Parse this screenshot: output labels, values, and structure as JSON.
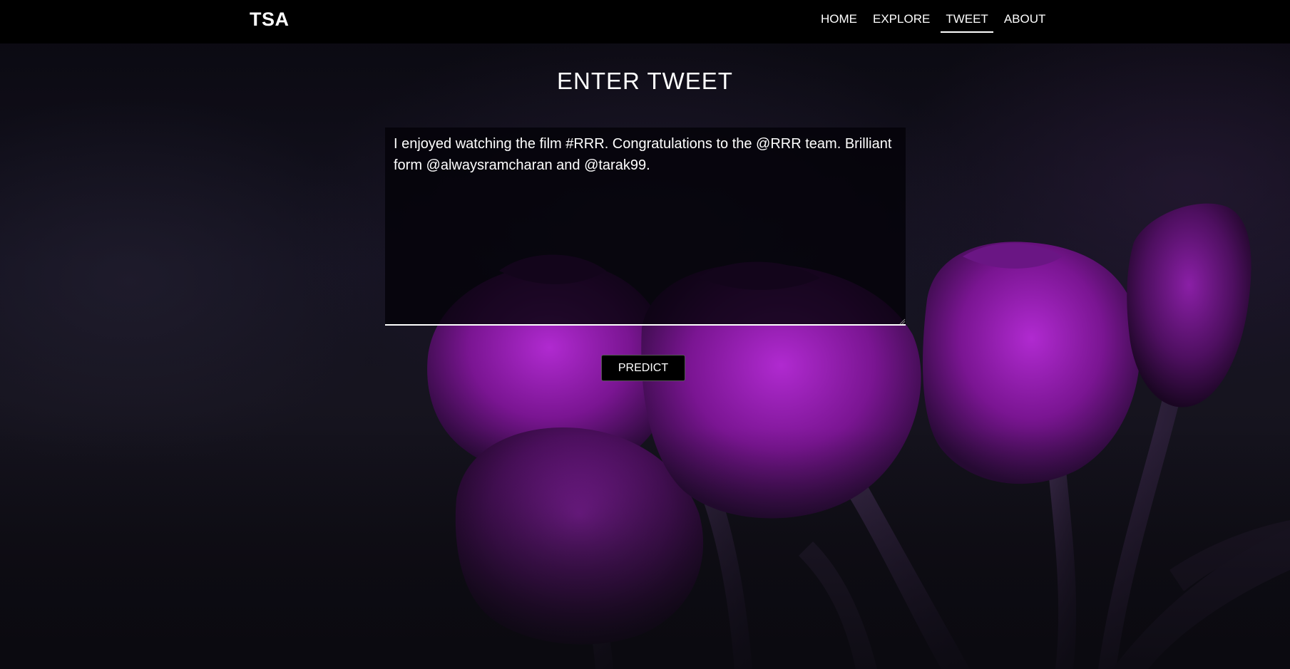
{
  "navbar": {
    "brand": "TSA",
    "items": [
      {
        "label": "HOME",
        "active": false
      },
      {
        "label": "EXPLORE",
        "active": false
      },
      {
        "label": "TWEET",
        "active": true
      },
      {
        "label": "ABOUT",
        "active": false
      }
    ]
  },
  "main": {
    "heading": "ENTER TWEET",
    "tweet_value": "I enjoyed watching the film #RRR. Congratulations to the @RRR team. Brilliant form @alwaysramcharan and @tarak99.",
    "predict_label": "PREDICT"
  },
  "colors": {
    "navbar_bg": "#000000",
    "text": "#ffffff",
    "tulip_purple": "#8a1fa6"
  },
  "background": {
    "decoration": "purple-tulips"
  }
}
